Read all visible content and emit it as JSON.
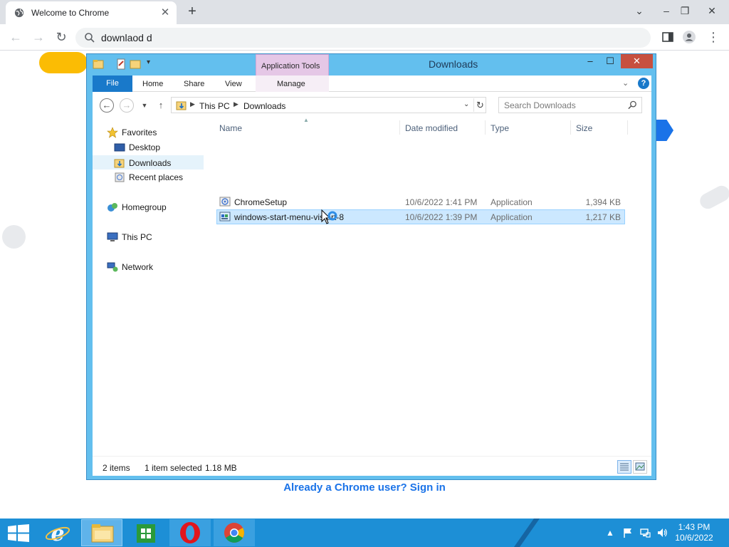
{
  "browser": {
    "tab_title": "Welcome to Chrome",
    "omnibox_text": "downlaod d",
    "signin_link": "Already a Chrome user? Sign in"
  },
  "explorer": {
    "title": "Downloads",
    "contextual_tab": "Application Tools",
    "ribbon_tabs": {
      "file": "File",
      "home": "Home",
      "share": "Share",
      "view": "View",
      "manage": "Manage"
    },
    "breadcrumb": [
      "This PC",
      "Downloads"
    ],
    "search_placeholder": "Search Downloads",
    "nav_pane": {
      "favorites": "Favorites",
      "desktop": "Desktop",
      "downloads": "Downloads",
      "recent_places": "Recent places",
      "homegroup": "Homegroup",
      "this_pc": "This PC",
      "network": "Network"
    },
    "columns": {
      "name": "Name",
      "date": "Date modified",
      "type": "Type",
      "size": "Size"
    },
    "files": [
      {
        "name": "ChromeSetup",
        "date": "10/6/2022 1:41 PM",
        "type": "Application",
        "size": "1,394 KB",
        "selected": false
      },
      {
        "name": "windows-start-menu-vistart-8",
        "date": "10/6/2022 1:39 PM",
        "type": "Application",
        "size": "1,217 KB",
        "selected": true
      }
    ],
    "status": {
      "items": "2 items",
      "selection": "1 item selected",
      "selection_size": "1.18 MB"
    }
  },
  "taskbar": {
    "time": "1:43 PM",
    "date": "10/6/2022"
  },
  "colors": {
    "taskbar": "#1d8fd6",
    "explorer_frame": "#63bfee",
    "selection": "#cce8ff",
    "link": "#1a73e8",
    "close_button": "#c7503f"
  }
}
